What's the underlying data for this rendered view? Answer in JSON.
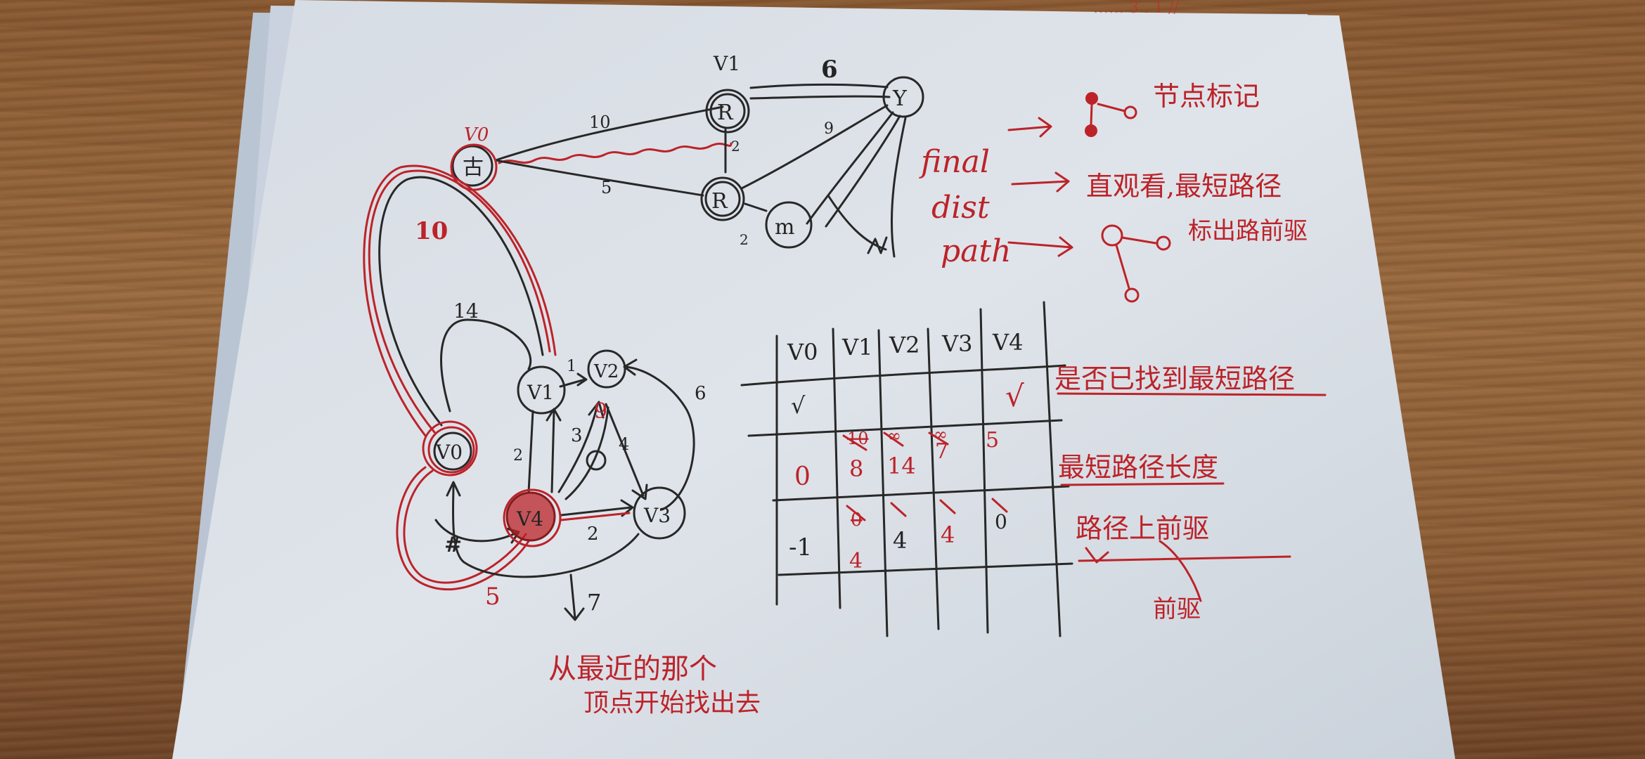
{
  "top_graph": {
    "vertex_labels": [
      "V0",
      "V1"
    ],
    "edge_labels": [
      "10",
      "5",
      "2",
      "9",
      "6",
      "2"
    ]
  },
  "legend": {
    "terms": [
      "final",
      "dist",
      "path"
    ],
    "notes": [
      "节点标记",
      "直观看,最短路径",
      "标出路前驱"
    ]
  },
  "bottom_graph": {
    "nodes": [
      "V0",
      "V1",
      "V2",
      "V3",
      "V4"
    ],
    "edge_labels": [
      "10",
      "14",
      "1",
      "6",
      "2",
      "3",
      "9",
      "4",
      "2",
      "7",
      "5"
    ]
  },
  "bottom_notes": [
    "从最近的那个",
    "顶点开始找出去"
  ],
  "table": {
    "headers": [
      "V0",
      "V1",
      "V2",
      "V3",
      "V4"
    ],
    "rows": {
      "final": [
        "√",
        "",
        "",
        "",
        "√"
      ],
      "dist_old": [
        "",
        "10",
        "∞",
        "∞",
        ""
      ],
      "dist_new": [
        "0",
        "8",
        "14",
        "7",
        "5"
      ],
      "path_old": [
        "",
        "0",
        "",
        "",
        ""
      ],
      "path_new": [
        "-1",
        "4",
        "4",
        "4",
        "0"
      ]
    },
    "row_notes": [
      "是否已找到最短路径",
      "最短路径长度",
      "路径上前驱"
    ],
    "footnote": "前驱"
  }
}
